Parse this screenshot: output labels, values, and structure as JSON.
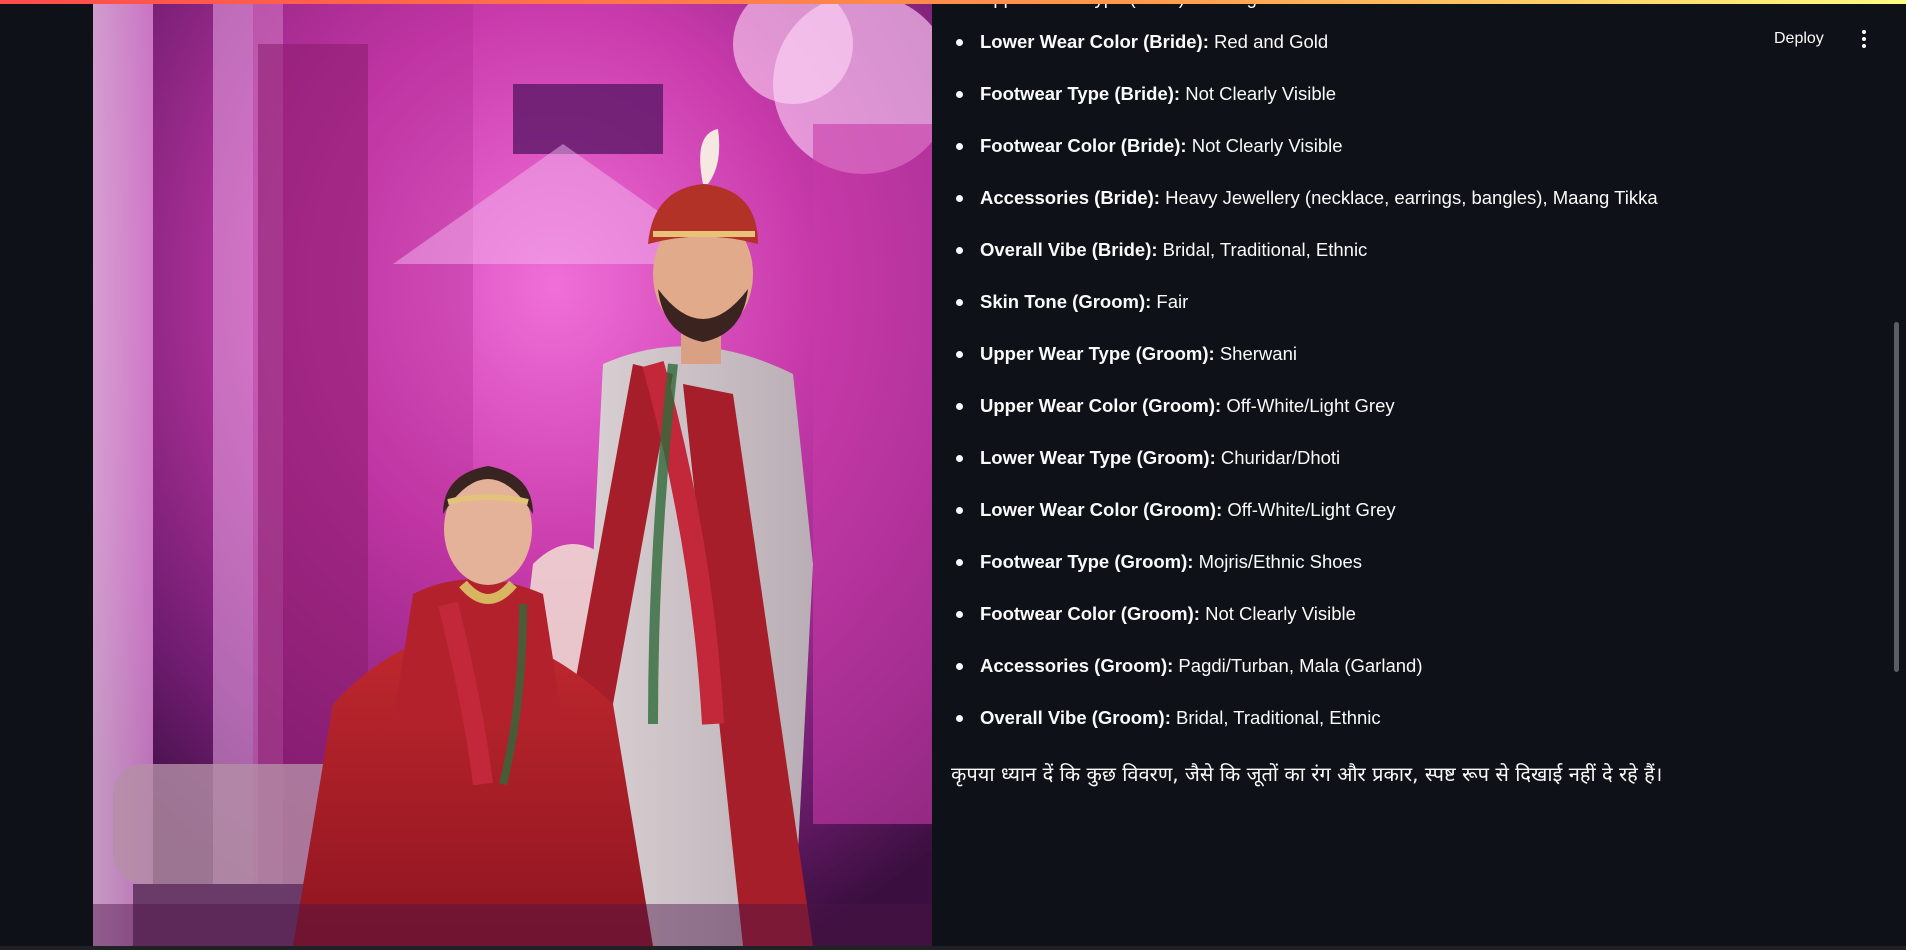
{
  "toolbar": {
    "deploy_label": "Deploy",
    "menu_icon": "vertical-ellipsis-icon"
  },
  "cut_off_item": "Upper Wear Type (Bride): Lehenga",
  "attributes": [
    {
      "key": "Lower Wear Color (Bride):",
      "value": " Red and Gold"
    },
    {
      "key": "Footwear Type (Bride):",
      "value": " Not Clearly Visible"
    },
    {
      "key": "Footwear Color (Bride):",
      "value": " Not Clearly Visible"
    },
    {
      "key": "Accessories (Bride):",
      "value": " Heavy Jewellery (necklace, earrings, bangles), Maang Tikka"
    },
    {
      "key": "Overall Vibe (Bride):",
      "value": " Bridal, Traditional, Ethnic"
    },
    {
      "key": "Skin Tone (Groom):",
      "value": " Fair"
    },
    {
      "key": "Upper Wear Type (Groom):",
      "value": " Sherwani"
    },
    {
      "key": "Upper Wear Color (Groom):",
      "value": " Off-White/Light Grey"
    },
    {
      "key": "Lower Wear Type (Groom):",
      "value": " Churidar/Dhoti"
    },
    {
      "key": "Lower Wear Color (Groom):",
      "value": " Off-White/Light Grey"
    },
    {
      "key": "Footwear Type (Groom):",
      "value": " Mojris/Ethnic Shoes"
    },
    {
      "key": "Footwear Color (Groom):",
      "value": " Not Clearly Visible"
    },
    {
      "key": "Accessories (Groom):",
      "value": " Pagdi/Turban, Mala (Garland)"
    },
    {
      "key": "Overall Vibe (Groom):",
      "value": " Bridal, Traditional, Ethnic"
    }
  ],
  "note": "कृपया ध्यान दें कि कुछ विवरण, जैसे कि जूतों का रंग और प्रकार, स्पष्ट रूप से दिखाई नहीं दे रहे हैं।",
  "colors": {
    "background": "#0e1117",
    "text": "#fafafa",
    "accent_stripe_start": "#ff4b4b",
    "accent_stripe_end": "#fffd80"
  }
}
